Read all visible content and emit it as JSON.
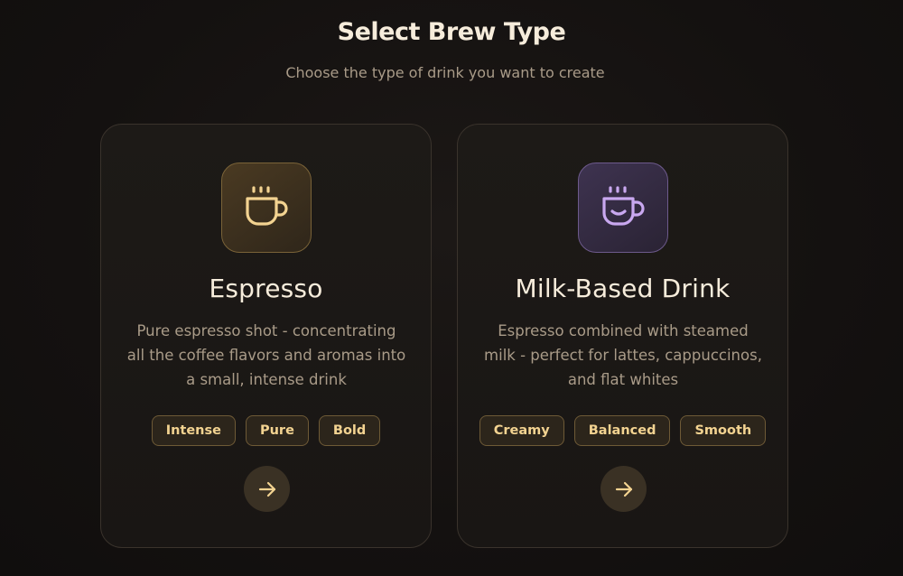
{
  "header": {
    "title": "Select Brew Type",
    "subtitle": "Choose the type of drink you want to create"
  },
  "cards": [
    {
      "title": "Espresso",
      "description": "Pure espresso shot - concentrating all the coffee flavors and aromas into a small, intense drink",
      "tags": [
        "Intense",
        "Pure",
        "Bold"
      ],
      "icon": "coffee-cup-icon",
      "accent": "#f3d391"
    },
    {
      "title": "Milk-Based Drink",
      "description": "Espresso combined with steamed milk - perfect for lattes, cappuccinos, and flat whites",
      "tags": [
        "Creamy",
        "Balanced",
        "Smooth"
      ],
      "icon": "smiling-cup-icon",
      "accent": "#c9a8f0"
    }
  ],
  "colors": {
    "background": "#141110",
    "tag_text": "#f3d391",
    "arrow": "#f3d391"
  }
}
